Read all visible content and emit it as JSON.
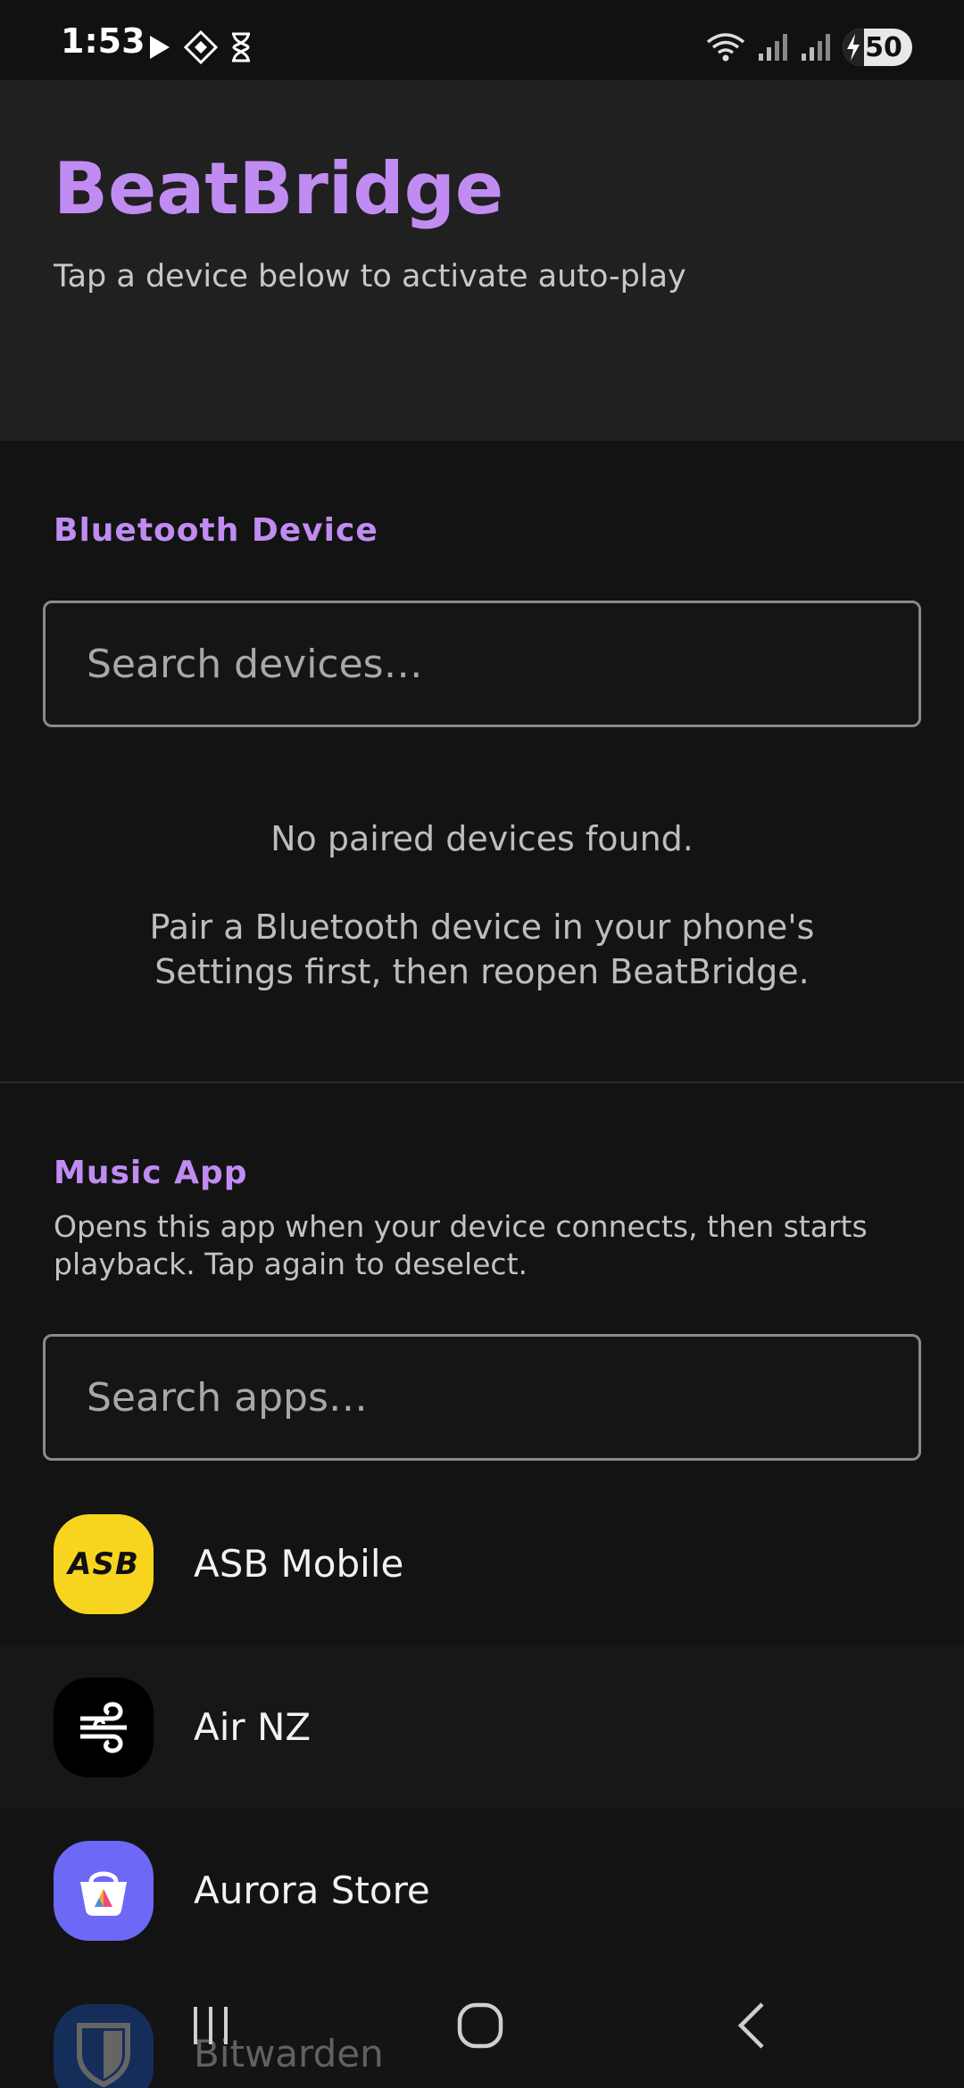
{
  "status_bar": {
    "time": "1:53",
    "battery": "50",
    "left_icons": [
      "play-icon",
      "navigation-diamond-icon",
      "hourglass-icon"
    ],
    "right_icons": [
      "wifi-icon",
      "signal-icon",
      "signal-icon",
      "battery-charging-icon"
    ]
  },
  "header": {
    "title": "BeatBridge",
    "subtitle": "Tap a device below to activate auto-play"
  },
  "bluetooth_section": {
    "label": "Bluetooth Device",
    "search_placeholder": "Search devices…",
    "empty_title": "No paired devices found.",
    "empty_hint": "Pair a Bluetooth device in your phone's Settings first, then reopen BeatBridge."
  },
  "music_section": {
    "label": "Music App",
    "description": "Opens this app when your device connects, then starts playback. Tap again to deselect.",
    "search_placeholder": "Search apps…",
    "apps": [
      {
        "name": "ASB Mobile",
        "icon": "asb-icon",
        "icon_text": "ASB",
        "color": "#f7d51f"
      },
      {
        "name": "Air NZ",
        "icon": "air-nz-koru-icon",
        "color": "#000000"
      },
      {
        "name": "Aurora Store",
        "icon": "aurora-store-bag-icon",
        "color": "#6d68f6"
      },
      {
        "name": "Bitwarden",
        "icon": "bitwarden-shield-icon",
        "color": "#175ddc"
      }
    ]
  },
  "colors": {
    "accent": "#c08cf2",
    "background": "#131313",
    "header_background": "#202020"
  },
  "nav_bar": {
    "items": [
      "recents-button",
      "home-button",
      "back-button"
    ]
  }
}
